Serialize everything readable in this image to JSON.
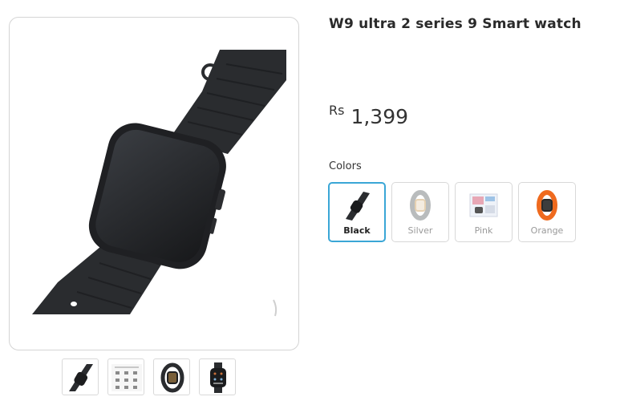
{
  "product": {
    "title": "W9 ultra 2 series 9 Smart watch",
    "price_currency": "Rs",
    "price_amount": "1,399"
  },
  "colors": {
    "label": "Colors",
    "selected": "Black",
    "options": [
      {
        "label": "Black",
        "strap_color": "#2b2d30"
      },
      {
        "label": "Silver",
        "strap_color": "#b9bcbd"
      },
      {
        "label": "Pink",
        "strap_color": "#e7a7b5"
      },
      {
        "label": "Orange",
        "strap_color": "#ef6a1e"
      }
    ]
  },
  "thumbnails": [
    {
      "icon": "black-watch-angled-icon"
    },
    {
      "icon": "manual-sheet-icon"
    },
    {
      "icon": "watch-front-strap-icon"
    },
    {
      "icon": "watch-face-screen-icon"
    }
  ],
  "theme": {
    "selected_border": "#3aa6d6",
    "frame_border": "#d4d4d4"
  }
}
